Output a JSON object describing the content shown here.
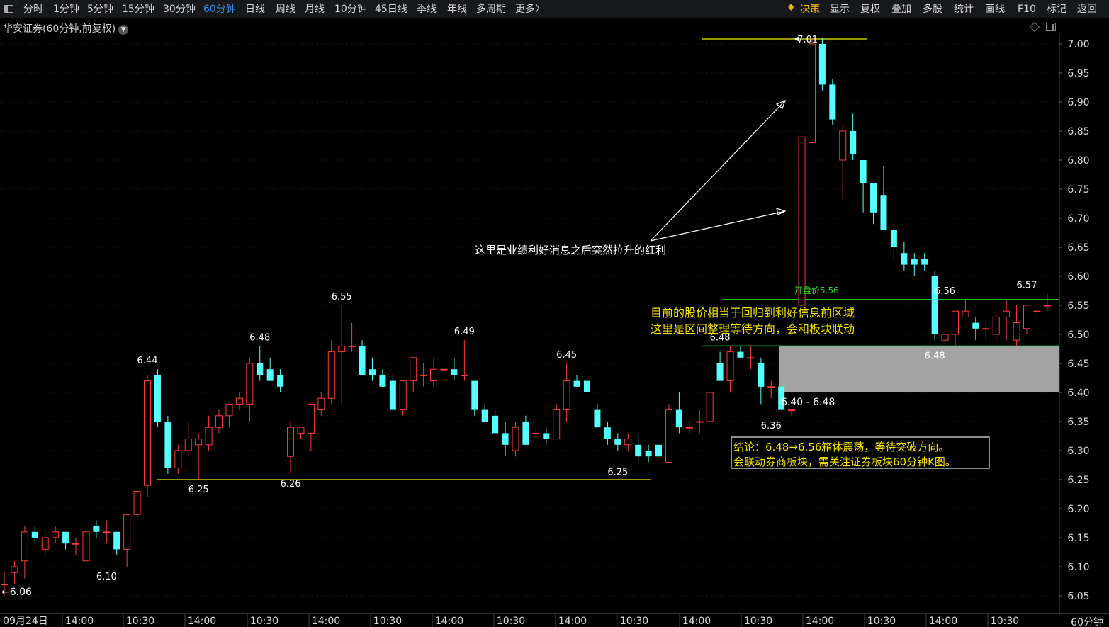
{
  "toolbar": {
    "left_items": [
      "分时",
      "1分钟",
      "5分钟",
      "15分钟",
      "30分钟",
      "60分钟",
      "日线",
      "周线",
      "月线",
      "10分钟",
      "45日线",
      "季线",
      "年线",
      "多周期",
      "更多〉"
    ],
    "active_item": "60分钟",
    "right_items": [
      "决策",
      "显示",
      "复权",
      "叠加",
      "多股",
      "统计",
      "画线",
      "F10",
      "标记",
      "返回"
    ],
    "accent_item": "决策"
  },
  "header": {
    "title": "华安证券(60分钟,前复权)"
  },
  "footer": {
    "timeframe": "60分钟"
  },
  "colors": {
    "up": "#ff3b3b",
    "down": "#54ffff",
    "support_line": "#c8c800",
    "range_line": "#18c418",
    "box_fill": "#c0c0c0",
    "note_text": "#f5e200"
  },
  "chart_data": {
    "type": "candlestick",
    "ylim": [
      6.02,
      7.02
    ],
    "y_ticks": [
      "7.00",
      "6.95",
      "6.90",
      "6.85",
      "6.80",
      "6.75",
      "6.70",
      "6.65",
      "6.60",
      "6.55",
      "6.50",
      "6.45",
      "6.40",
      "6.35",
      "6.30",
      "6.25",
      "6.20",
      "6.15",
      "6.10",
      "6.05"
    ],
    "x_ticks": [
      "09月24日",
      "14:00",
      "10:30",
      "14:00",
      "10:30",
      "14:00",
      "10:30",
      "14:00",
      "10:30",
      "14:00",
      "10:30",
      "14:00",
      "10:30",
      "14:00",
      "10:30",
      "14:00",
      "10:30"
    ],
    "candles": [
      [
        6.07,
        6.09,
        6.05,
        6.07
      ],
      [
        6.09,
        6.11,
        6.07,
        6.1
      ],
      [
        6.11,
        6.17,
        6.08,
        6.16
      ],
      [
        6.16,
        6.17,
        6.14,
        6.15
      ],
      [
        6.13,
        6.16,
        6.12,
        6.15
      ],
      [
        6.15,
        6.17,
        6.14,
        6.16
      ],
      [
        6.16,
        6.16,
        6.13,
        6.14
      ],
      [
        6.14,
        6.15,
        6.12,
        6.14
      ],
      [
        6.11,
        6.17,
        6.1,
        6.16
      ],
      [
        6.17,
        6.18,
        6.15,
        6.16
      ],
      [
        6.16,
        6.18,
        6.14,
        6.16
      ],
      [
        6.16,
        6.16,
        6.12,
        6.13
      ],
      [
        6.13,
        6.19,
        6.1,
        6.19
      ],
      [
        6.19,
        6.24,
        6.18,
        6.23
      ],
      [
        6.24,
        6.43,
        6.22,
        6.42
      ],
      [
        6.43,
        6.44,
        6.34,
        6.35
      ],
      [
        6.35,
        6.36,
        6.26,
        6.27
      ],
      [
        6.27,
        6.31,
        6.26,
        6.3
      ],
      [
        6.3,
        6.35,
        6.29,
        6.32
      ],
      [
        6.31,
        6.33,
        6.25,
        6.32
      ],
      [
        6.31,
        6.36,
        6.3,
        6.34
      ],
      [
        6.34,
        6.37,
        6.33,
        6.36
      ],
      [
        6.36,
        6.38,
        6.34,
        6.38
      ],
      [
        6.38,
        6.4,
        6.37,
        6.39
      ],
      [
        6.38,
        6.46,
        6.35,
        6.45
      ],
      [
        6.45,
        6.48,
        6.42,
        6.43
      ],
      [
        6.44,
        6.46,
        6.42,
        6.42
      ],
      [
        6.43,
        6.44,
        6.4,
        6.41
      ],
      [
        6.29,
        6.35,
        6.26,
        6.34
      ],
      [
        6.33,
        6.34,
        6.32,
        6.34
      ],
      [
        6.33,
        6.38,
        6.3,
        6.38
      ],
      [
        6.37,
        6.4,
        6.36,
        6.39
      ],
      [
        6.39,
        6.49,
        6.38,
        6.47
      ],
      [
        6.47,
        6.55,
        6.38,
        6.48
      ],
      [
        6.48,
        6.52,
        6.47,
        6.48
      ],
      [
        6.48,
        6.49,
        6.43,
        6.43
      ],
      [
        6.44,
        6.46,
        6.42,
        6.43
      ],
      [
        6.43,
        6.44,
        6.41,
        6.41
      ],
      [
        6.42,
        6.43,
        6.37,
        6.37
      ],
      [
        6.37,
        6.42,
        6.36,
        6.42
      ],
      [
        6.42,
        6.46,
        6.4,
        6.46
      ],
      [
        6.43,
        6.45,
        6.41,
        6.43
      ],
      [
        6.42,
        6.46,
        6.41,
        6.44
      ],
      [
        6.44,
        6.45,
        6.41,
        6.44
      ],
      [
        6.44,
        6.46,
        6.42,
        6.43
      ],
      [
        6.43,
        6.49,
        6.42,
        6.43
      ],
      [
        6.42,
        6.42,
        6.36,
        6.37
      ],
      [
        6.37,
        6.38,
        6.35,
        6.35
      ],
      [
        6.36,
        6.37,
        6.33,
        6.33
      ],
      [
        6.33,
        6.35,
        6.29,
        6.31
      ],
      [
        6.3,
        6.35,
        6.29,
        6.34
      ],
      [
        6.35,
        6.36,
        6.31,
        6.31
      ],
      [
        6.33,
        6.34,
        6.32,
        6.33
      ],
      [
        6.33,
        6.34,
        6.31,
        6.32
      ],
      [
        6.32,
        6.38,
        6.32,
        6.37
      ],
      [
        6.37,
        6.45,
        6.35,
        6.42
      ],
      [
        6.42,
        6.43,
        6.41,
        6.41
      ],
      [
        6.42,
        6.43,
        6.39,
        6.4
      ],
      [
        6.37,
        6.38,
        6.34,
        6.34
      ],
      [
        6.34,
        6.35,
        6.31,
        6.32
      ],
      [
        6.32,
        6.33,
        6.3,
        6.31
      ],
      [
        6.31,
        6.33,
        6.3,
        6.32
      ],
      [
        6.31,
        6.33,
        6.28,
        6.29
      ],
      [
        6.3,
        6.31,
        6.28,
        6.29
      ],
      [
        6.31,
        6.31,
        6.29,
        6.29
      ],
      [
        6.28,
        6.38,
        6.28,
        6.37
      ],
      [
        6.37,
        6.4,
        6.33,
        6.34
      ],
      [
        6.34,
        6.35,
        6.33,
        6.34
      ],
      [
        6.35,
        6.37,
        6.33,
        6.35
      ],
      [
        6.35,
        6.4,
        6.35,
        6.4
      ],
      [
        6.45,
        6.47,
        6.42,
        6.42
      ],
      [
        6.42,
        6.48,
        6.4,
        6.47
      ],
      [
        6.47,
        6.48,
        6.46,
        6.46
      ],
      [
        6.46,
        6.48,
        6.44,
        6.46
      ],
      [
        6.45,
        6.46,
        6.38,
        6.41
      ],
      [
        6.41,
        6.42,
        6.39,
        6.41
      ],
      [
        6.41,
        6.41,
        6.37,
        6.37
      ],
      [
        6.37,
        6.37,
        6.36,
        6.37
      ],
      [
        6.55,
        6.84,
        6.55,
        6.84
      ],
      [
        6.83,
        7.01,
        6.83,
        7.0
      ],
      [
        7.0,
        7.01,
        6.92,
        6.93
      ],
      [
        6.93,
        6.94,
        6.86,
        6.87
      ],
      [
        6.8,
        6.86,
        6.73,
        6.85
      ],
      [
        6.85,
        6.88,
        6.8,
        6.81
      ],
      [
        6.8,
        6.8,
        6.71,
        6.76
      ],
      [
        6.76,
        6.76,
        6.69,
        6.71
      ],
      [
        6.74,
        6.79,
        6.68,
        6.68
      ],
      [
        6.68,
        6.69,
        6.63,
        6.65
      ],
      [
        6.64,
        6.66,
        6.61,
        6.62
      ],
      [
        6.63,
        6.64,
        6.6,
        6.62
      ],
      [
        6.63,
        6.64,
        6.61,
        6.62
      ],
      [
        6.6,
        6.61,
        6.49,
        6.5
      ],
      [
        6.49,
        6.52,
        6.49,
        6.5
      ],
      [
        6.5,
        6.54,
        6.48,
        6.54
      ],
      [
        6.53,
        6.56,
        6.53,
        6.54
      ],
      [
        6.52,
        6.53,
        6.49,
        6.51
      ],
      [
        6.51,
        6.52,
        6.49,
        6.51
      ],
      [
        6.5,
        6.54,
        6.49,
        6.53
      ],
      [
        6.53,
        6.56,
        6.49,
        6.54
      ],
      [
        6.49,
        6.55,
        6.48,
        6.52
      ],
      [
        6.51,
        6.55,
        6.5,
        6.55
      ],
      [
        6.54,
        6.55,
        6.53,
        6.54
      ],
      [
        6.55,
        6.57,
        6.54,
        6.55
      ]
    ],
    "price_labels": [
      {
        "text": "6.10",
        "candle": 10,
        "value": 6.1,
        "pos": "below"
      },
      {
        "text": "6.44",
        "candle": 14,
        "value": 6.44,
        "pos": "above"
      },
      {
        "text": "6.25",
        "candle": 19,
        "value": 6.25,
        "pos": "below"
      },
      {
        "text": "6.48",
        "candle": 25,
        "value": 6.48,
        "pos": "above"
      },
      {
        "text": "6.26",
        "candle": 28,
        "value": 6.26,
        "pos": "below"
      },
      {
        "text": "6.55",
        "candle": 33,
        "value": 6.55,
        "pos": "above"
      },
      {
        "text": "6.49",
        "candle": 45,
        "value": 6.49,
        "pos": "above"
      },
      {
        "text": "6.45",
        "candle": 55,
        "value": 6.45,
        "pos": "above"
      },
      {
        "text": "6.25",
        "candle": 60,
        "value": 6.28,
        "pos": "below"
      },
      {
        "text": "6.48",
        "candle": 70,
        "value": 6.48,
        "pos": "above"
      },
      {
        "text": "6.36",
        "candle": 75,
        "value": 6.36,
        "pos": "below"
      },
      {
        "text": "7.01",
        "candle": 77,
        "value": 7.01,
        "pos": "right"
      },
      {
        "text": "6.56",
        "candle": 92,
        "value": 6.56,
        "pos": "above"
      },
      {
        "text": "6.48",
        "candle": 91,
        "value": 6.48,
        "pos": "below"
      },
      {
        "text": "6.57",
        "candle": 100,
        "value": 6.57,
        "pos": "above"
      }
    ],
    "start_label": "←6.06",
    "annotations": {
      "rally_note": "这里是业绩利好消息之后突然拉升的红利",
      "open_price_label": "开盘价5.56",
      "range_note_line1": "目前的股价相当于回归到利好信息前区域",
      "range_note_line2": "这里是区间整理等待方向，会和板块联动",
      "box_label": "6.40 - 6.48",
      "conclusion_line1": "结论：6.48→6.56箱体震荡，等待突破方向。",
      "conclusion_line2": "会联动券商板块，需关注证券板块60分钟K图。"
    },
    "levels": {
      "support": 6.25,
      "peak": 7.01,
      "range_top": 6.56,
      "range_bottom": 6.48,
      "box_top": 6.48,
      "box_bottom": 6.4
    }
  }
}
